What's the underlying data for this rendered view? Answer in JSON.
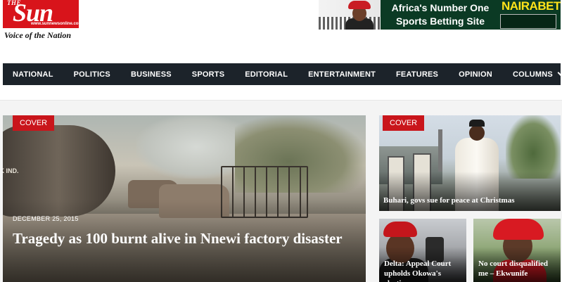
{
  "header": {
    "logo_the": "THE",
    "logo_name": "Sun",
    "logo_url": "www.sunnewsonline.com",
    "tagline": "Voice of the Nation",
    "ad": {
      "line1": "Africa's Number One",
      "line2": "Sports Betting Site",
      "brand": "NAIRABET"
    }
  },
  "nav": {
    "items": [
      "NATIONAL",
      "POLITICS",
      "BUSINESS",
      "SPORTS",
      "EDITORIAL",
      "ENTERTAINMENT",
      "FEATURES",
      "OPINION",
      "COLUMNS"
    ]
  },
  "main_story": {
    "badge": "COVER",
    "date": "DECEMBER 25, 2015",
    "title": "Tragedy as 100 burnt alive in Nnewi factory disaster",
    "image_text": "OCK IND."
  },
  "side_story": {
    "badge": "COVER",
    "title": "Buhari, govs sue for peace at Christmas"
  },
  "cards": [
    {
      "title": "Delta: Appeal Court upholds Okowa's election"
    },
    {
      "title": "No court disqualified me – Ekwunife"
    }
  ],
  "colors": {
    "brand_red": "#d8141b",
    "nav_bg": "#1c232a",
    "badge_red": "#c9151b",
    "ad_green": "#0b3a24",
    "ad_brand_yellow": "#ffe31a"
  }
}
